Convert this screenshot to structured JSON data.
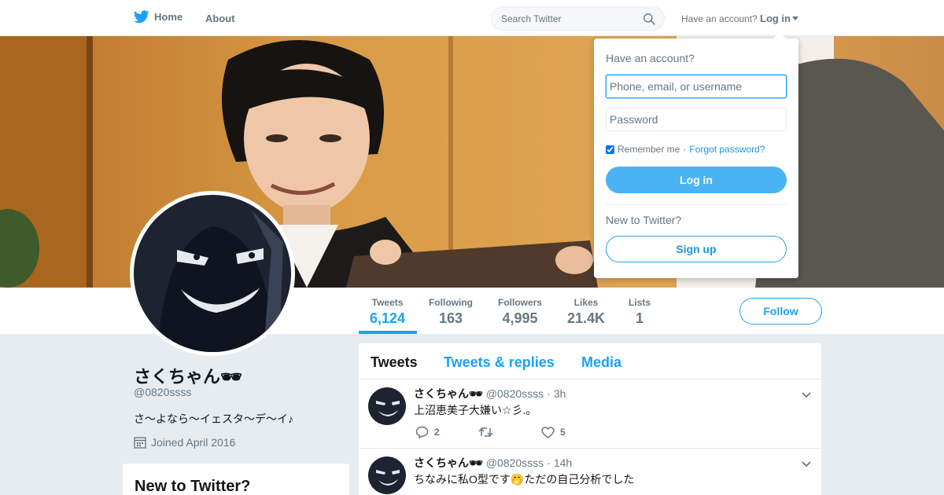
{
  "nav": {
    "home_label": "Home",
    "about_label": "About",
    "search_placeholder": "Search Twitter",
    "have_account": "Have an account?",
    "login_label": "Log in"
  },
  "profile": {
    "name": "さくちゃん🕶",
    "handle": "@0820ssss",
    "bio": "さ〜よなら〜イェスタ〜デ〜イ♪",
    "joined": "Joined April 2016",
    "follow_label": "Follow"
  },
  "stats": [
    {
      "label": "Tweets",
      "value": "6,124"
    },
    {
      "label": "Following",
      "value": "163"
    },
    {
      "label": "Followers",
      "value": "4,995"
    },
    {
      "label": "Likes",
      "value": "21.4K"
    },
    {
      "label": "Lists",
      "value": "1"
    }
  ],
  "tabs": [
    "Tweets",
    "Tweets & replies",
    "Media"
  ],
  "tweets": [
    {
      "name": "さくちゃん🕶",
      "handle": "@0820ssss",
      "time": "3h",
      "text": "上沼恵美子大嫌い☆彡.。",
      "replies": "2",
      "retweets": "",
      "likes": "5"
    },
    {
      "name": "さくちゃん🕶",
      "handle": "@0820ssss",
      "time": "14h",
      "text": "ちなみに私O型です🤭ただの自己分析でした",
      "replies": "",
      "retweets": "",
      "likes": ""
    }
  ],
  "sidebar": {
    "new_title": "New to Twitter?"
  },
  "login_dropdown": {
    "title": "Have an account?",
    "username_placeholder": "Phone, email, or username",
    "password_placeholder": "Password",
    "remember_label": "Remember me",
    "separator": "·",
    "forgot_label": "Forgot password?",
    "login_button": "Log in",
    "new_label": "New to Twitter?",
    "signup_button": "Sign up"
  },
  "colors": {
    "accent": "#1da1f2",
    "background": "#e6ecf0"
  }
}
